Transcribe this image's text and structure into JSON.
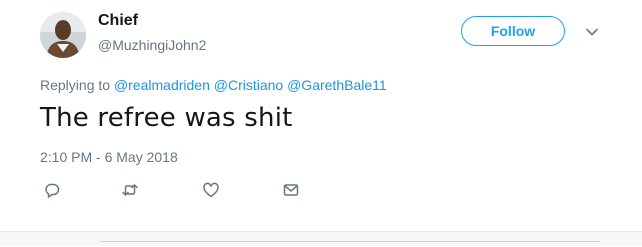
{
  "author": {
    "display_name": "Chief",
    "handle": "@MuzhingiJohn2"
  },
  "header": {
    "follow_label": "Follow",
    "menu_icon": "chevron-down-icon"
  },
  "reply_context": {
    "prefix": "Replying to",
    "mentions": [
      "@realmadriden",
      "@Cristiano",
      "@GarethBale11"
    ]
  },
  "tweet": {
    "text": "The refree was shit",
    "timestamp": "2:10 PM - 6 May 2018"
  },
  "actions": [
    {
      "icon": "reply-icon"
    },
    {
      "icon": "retweet-icon"
    },
    {
      "icon": "like-icon"
    },
    {
      "icon": "direct-message-icon"
    }
  ],
  "colors": {
    "accent": "#1da1f2",
    "link": "#1b95e0",
    "secondary_text": "#657786",
    "primary_text": "#14171a"
  }
}
